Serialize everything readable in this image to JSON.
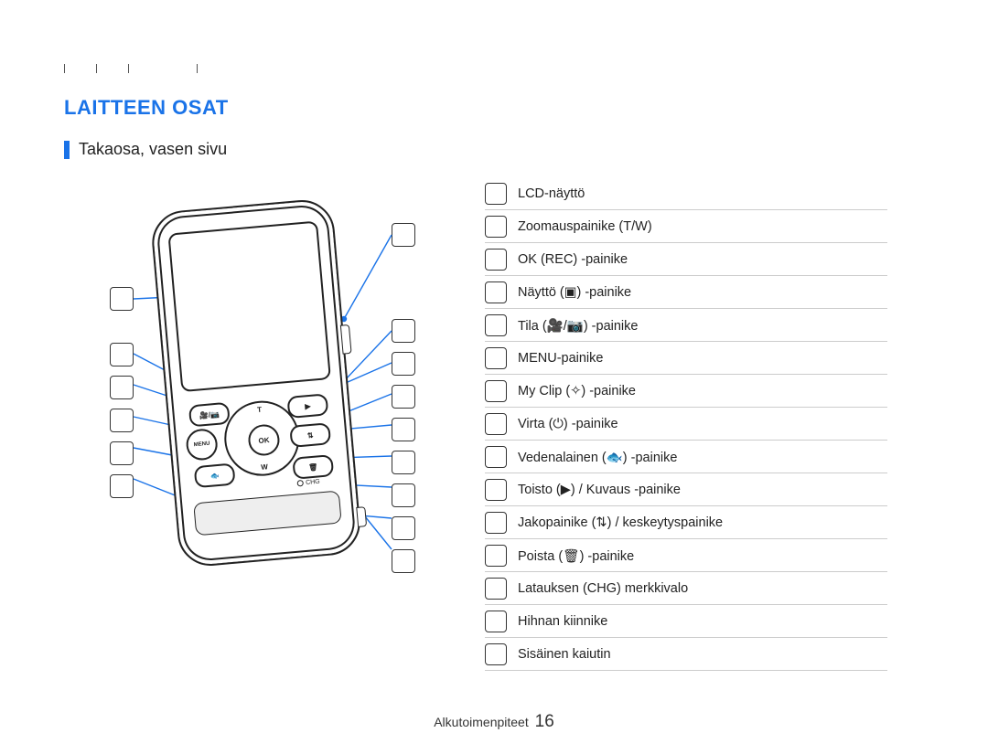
{
  "section_title": "LAITTEEN OSAT",
  "subtitle": "Takaosa, vasen sivu",
  "legend": [
    {
      "label": "LCD-näyttö",
      "icon": ""
    },
    {
      "label": "Zoomauspainike (T/W)",
      "icon": ""
    },
    {
      "label": "OK (REC) -painike",
      "icon": ""
    },
    {
      "label": "Näyttö (▣) -painike",
      "icon": ""
    },
    {
      "label": "Tila (🎥/📷) -painike",
      "icon": ""
    },
    {
      "label": "MENU-painike",
      "icon": ""
    },
    {
      "label": "My Clip (✧) -painike",
      "icon": ""
    },
    {
      "label": "Virta (⏻) -painike",
      "icon": ""
    },
    {
      "label": "Vedenalainen (🐟) -painike",
      "icon": ""
    },
    {
      "label": "Toisto (▶) / Kuvaus -painike",
      "icon": ""
    },
    {
      "label": "Jakopainike (⇅) / keskeytyspainike",
      "icon": ""
    },
    {
      "label": "Poista (🗑) -painike",
      "icon": ""
    },
    {
      "label": "Latauksen (CHG) merkkivalo",
      "icon": ""
    },
    {
      "label": "Hihnan kiinnike",
      "icon": ""
    },
    {
      "label": "Sisäinen kaiutin",
      "icon": ""
    }
  ],
  "device": {
    "center_btn": "OK",
    "zoom_t": "T",
    "zoom_w": "W",
    "menu_label": "MENU",
    "chg_label": "CHG"
  },
  "footer_section": "Alkutoimenpiteet",
  "page_number": "16"
}
